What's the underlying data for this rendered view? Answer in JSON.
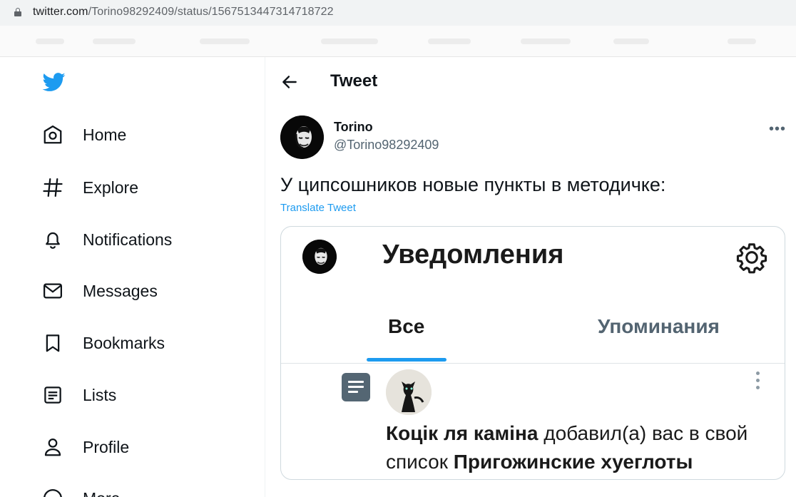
{
  "browser": {
    "url_host": "twitter.com",
    "url_path": "/Torino98292409/status/1567513447314718722"
  },
  "sidebar": {
    "items": [
      {
        "label": "Home",
        "icon": "home-icon"
      },
      {
        "label": "Explore",
        "icon": "hashtag-icon"
      },
      {
        "label": "Notifications",
        "icon": "bell-icon"
      },
      {
        "label": "Messages",
        "icon": "envelope-icon"
      },
      {
        "label": "Bookmarks",
        "icon": "bookmark-icon"
      },
      {
        "label": "Lists",
        "icon": "list-icon"
      },
      {
        "label": "Profile",
        "icon": "person-icon"
      },
      {
        "label": "More",
        "icon": "more-circle-icon"
      }
    ]
  },
  "header": {
    "title": "Tweet"
  },
  "tweet": {
    "author_name": "Torino",
    "author_handle": "@Torino98292409",
    "text": "У ципсошников новые пункты в методичке:",
    "translate_label": "Translate Tweet"
  },
  "embedded_image": {
    "title": "Уведомления",
    "tab_all": "Все",
    "tab_mentions": "Упоминания",
    "notification_user": "Коцік ля каміна",
    "notification_action": " добавил(а) вас в свой",
    "notification_prefix": "список ",
    "notification_list": "Пригожинские хуеглоты"
  },
  "colors": {
    "accent": "#1d9bf0",
    "text_primary": "#0f1419",
    "text_secondary": "#536471"
  }
}
